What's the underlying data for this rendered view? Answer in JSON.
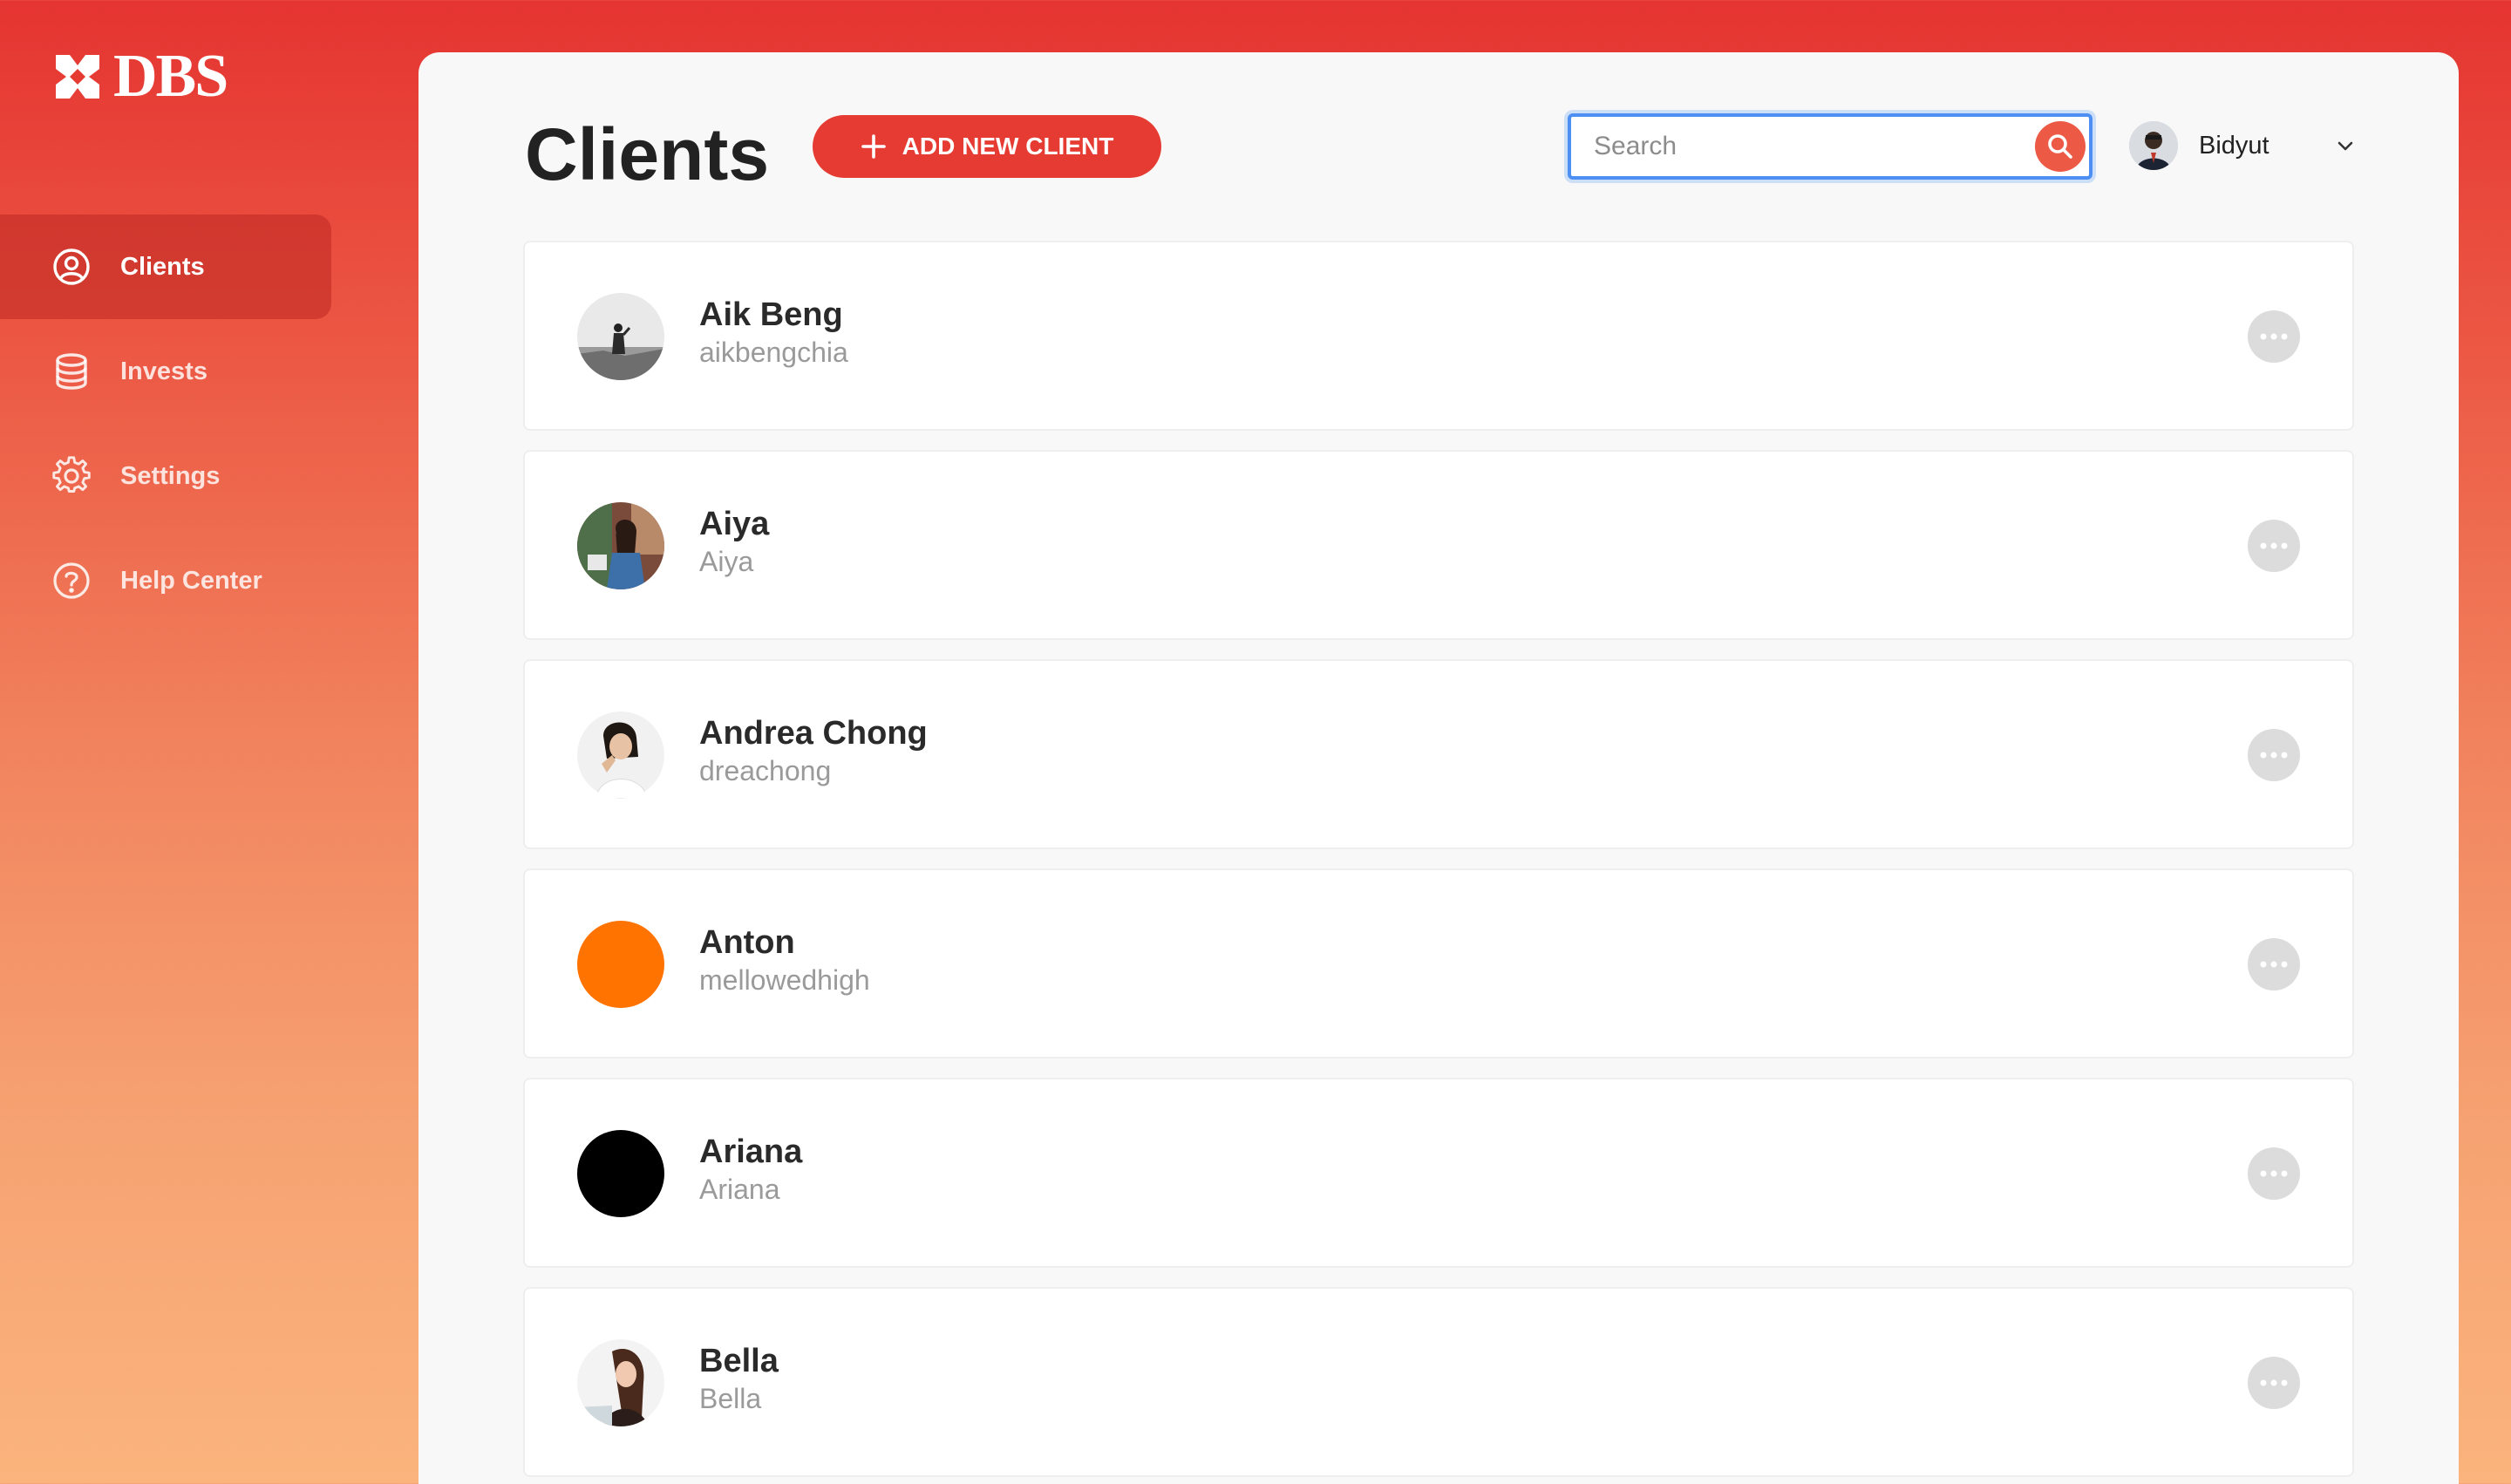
{
  "brand": {
    "name": "DBS",
    "logo_icon": "dbs-star-logo-icon"
  },
  "sidebar": {
    "items": [
      {
        "label": "Clients",
        "icon": "user-circle-icon",
        "active": true
      },
      {
        "label": "Invests",
        "icon": "database-icon",
        "active": false
      },
      {
        "label": "Settings",
        "icon": "gear-icon",
        "active": false
      },
      {
        "label": "Help Center",
        "icon": "help-circle-icon",
        "active": false
      }
    ]
  },
  "header": {
    "title": "Clients",
    "add_button_label": "ADD NEW CLIENT",
    "add_button_icon": "plus-icon",
    "search": {
      "placeholder": "Search",
      "value": "",
      "icon": "search-icon"
    },
    "user": {
      "name": "Bidyut",
      "menu_icon": "chevron-down-icon"
    }
  },
  "clients": [
    {
      "name": "Aik Beng",
      "handle": "aikbengchia",
      "avatar": "photo"
    },
    {
      "name": "Aiya",
      "handle": "Aiya",
      "avatar": "photo"
    },
    {
      "name": "Andrea Chong",
      "handle": "dreachong",
      "avatar": "photo"
    },
    {
      "name": "Anton",
      "handle": "mellowedhigh",
      "avatar": "solid",
      "avatar_color": "#ff7300"
    },
    {
      "name": "Ariana",
      "handle": "Ariana",
      "avatar": "solid",
      "avatar_color": "#000000"
    },
    {
      "name": "Bella",
      "handle": "Bella",
      "avatar": "photo"
    }
  ],
  "colors": {
    "accent": "#e63b33",
    "focus_ring": "#4d8ff2",
    "gradient_top": "#e53431",
    "gradient_bottom": "#fbb47d"
  }
}
